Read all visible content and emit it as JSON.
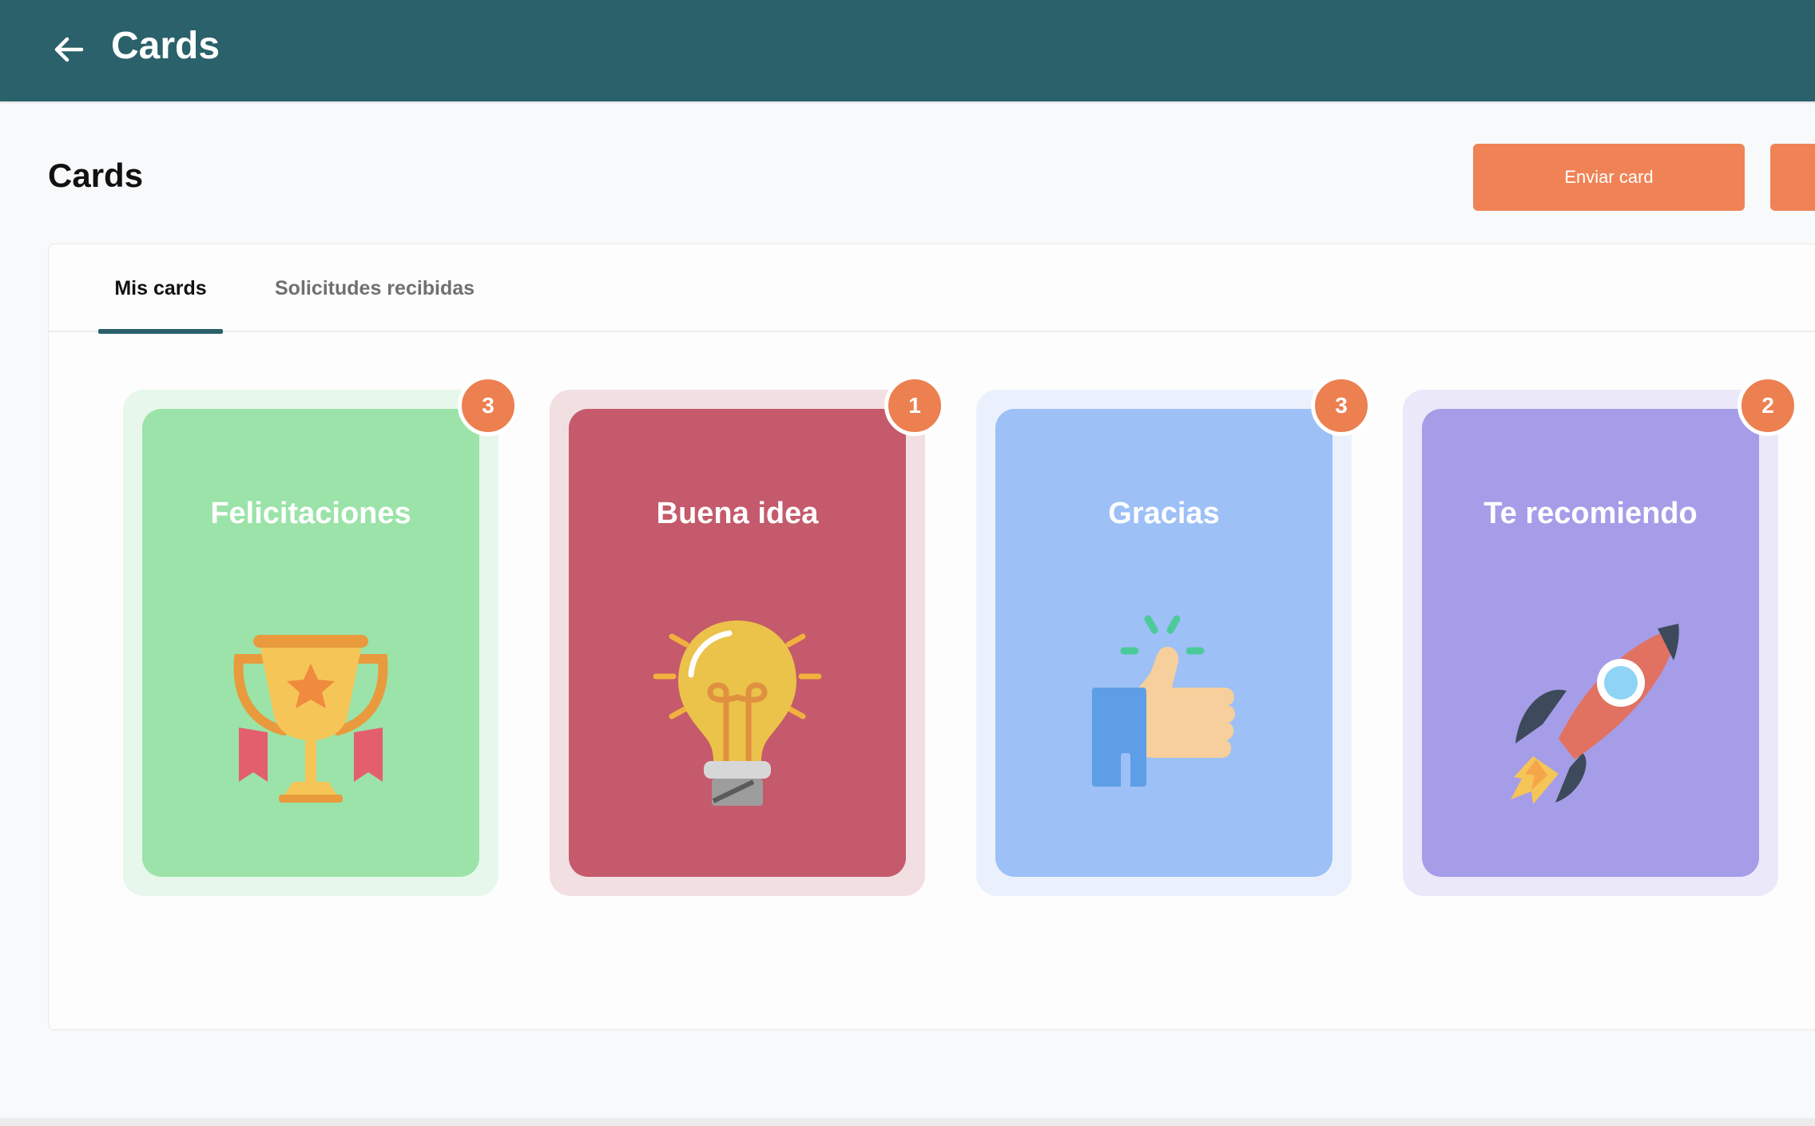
{
  "header": {
    "title": "Cards",
    "back_icon": "arrow-left-icon"
  },
  "page": {
    "title": "Cards"
  },
  "actions": {
    "send_card": "Enviar card",
    "extra_button": ""
  },
  "tabs": [
    {
      "label": "Mis cards",
      "active": true
    },
    {
      "label": "Solicitudes recibidas",
      "active": false
    }
  ],
  "cards": [
    {
      "title": "Felicitaciones",
      "count": "3",
      "icon": "trophy-icon",
      "color": "#9be3a8",
      "outer_color": "#e8f7ec"
    },
    {
      "title": "Buena idea",
      "count": "1",
      "icon": "lightbulb-icon",
      "color": "#c45a6b",
      "outer_color": "#f2dfe2"
    },
    {
      "title": "Gracias",
      "count": "3",
      "icon": "thumbs-up-icon",
      "color": "#9dc0f6",
      "outer_color": "#ebf1fc"
    },
    {
      "title": "Te recomiendo",
      "count": "2",
      "icon": "rocket-icon",
      "color": "#a59de8",
      "outer_color": "#ebe9f9"
    }
  ],
  "colors": {
    "header": "#2a616b",
    "accent": "#ef8356",
    "badge": "#ec8050"
  }
}
